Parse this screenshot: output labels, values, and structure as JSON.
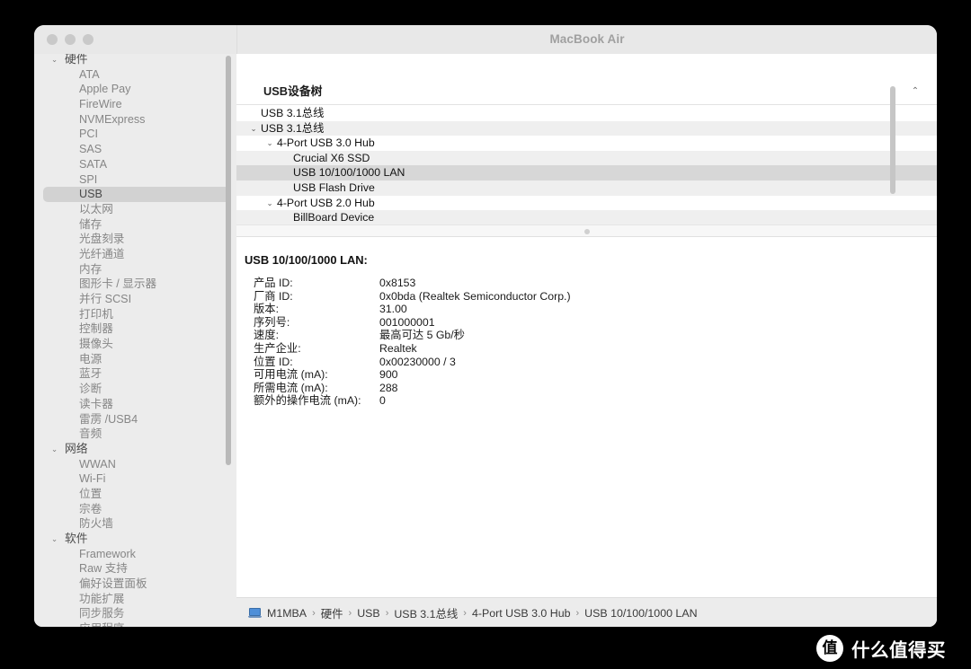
{
  "window": {
    "title": "MacBook Air",
    "traffic_lights": [
      "close-button",
      "minimize-button",
      "zoom-button"
    ]
  },
  "sidebar": {
    "groups": [
      {
        "label": "硬件",
        "expanded": true,
        "items": [
          {
            "label": "ATA",
            "selected": false
          },
          {
            "label": "Apple Pay",
            "selected": false
          },
          {
            "label": "FireWire",
            "selected": false
          },
          {
            "label": "NVMExpress",
            "selected": false
          },
          {
            "label": "PCI",
            "selected": false
          },
          {
            "label": "SAS",
            "selected": false
          },
          {
            "label": "SATA",
            "selected": false
          },
          {
            "label": "SPI",
            "selected": false
          },
          {
            "label": "USB",
            "selected": true
          },
          {
            "label": "以太网",
            "selected": false
          },
          {
            "label": "储存",
            "selected": false
          },
          {
            "label": "光盘刻录",
            "selected": false
          },
          {
            "label": "光纤通道",
            "selected": false
          },
          {
            "label": "内存",
            "selected": false
          },
          {
            "label": "图形卡 / 显示器",
            "selected": false
          },
          {
            "label": "并行 SCSI",
            "selected": false
          },
          {
            "label": "打印机",
            "selected": false
          },
          {
            "label": "控制器",
            "selected": false
          },
          {
            "label": "摄像头",
            "selected": false
          },
          {
            "label": "电源",
            "selected": false
          },
          {
            "label": "蓝牙",
            "selected": false
          },
          {
            "label": "诊断",
            "selected": false
          },
          {
            "label": "读卡器",
            "selected": false
          },
          {
            "label": "雷雳 /USB4",
            "selected": false
          },
          {
            "label": "音频",
            "selected": false
          }
        ]
      },
      {
        "label": "网络",
        "expanded": true,
        "items": [
          {
            "label": "WWAN",
            "selected": false
          },
          {
            "label": "Wi-Fi",
            "selected": false
          },
          {
            "label": "位置",
            "selected": false
          },
          {
            "label": "宗卷",
            "selected": false
          },
          {
            "label": "防火墙",
            "selected": false
          }
        ]
      },
      {
        "label": "软件",
        "expanded": true,
        "items": [
          {
            "label": "Framework",
            "selected": false
          },
          {
            "label": "Raw 支持",
            "selected": false
          },
          {
            "label": "偏好设置面板",
            "selected": false
          },
          {
            "label": "功能扩展",
            "selected": false
          },
          {
            "label": "同步服务",
            "selected": false
          },
          {
            "label": "应用程序",
            "selected": false
          }
        ]
      }
    ],
    "twisty_expanded_glyph": "⌄"
  },
  "tree": {
    "header_title": "USB设备树",
    "collapse_glyph": "⌃",
    "rows": [
      {
        "label": "USB 3.1总线",
        "depth": 0,
        "twisty": "",
        "stripe": false,
        "selected": false
      },
      {
        "label": "USB 3.1总线",
        "depth": 0,
        "twisty": "⌄",
        "stripe": true,
        "selected": false
      },
      {
        "label": "4-Port USB 3.0 Hub",
        "depth": 1,
        "twisty": "⌄",
        "stripe": false,
        "selected": false
      },
      {
        "label": "Crucial X6 SSD",
        "depth": 2,
        "twisty": "",
        "stripe": true,
        "selected": false
      },
      {
        "label": "USB 10/100/1000 LAN",
        "depth": 2,
        "twisty": "",
        "stripe": false,
        "selected": true
      },
      {
        "label": "USB Flash Drive",
        "depth": 2,
        "twisty": "",
        "stripe": true,
        "selected": false
      },
      {
        "label": "4-Port USB 2.0 Hub",
        "depth": 1,
        "twisty": "⌄",
        "stripe": false,
        "selected": false
      },
      {
        "label": "BillBoard Device",
        "depth": 2,
        "twisty": "",
        "stripe": true,
        "selected": false
      }
    ]
  },
  "detail": {
    "title": "USB 10/100/1000 LAN:",
    "properties": [
      {
        "label": "产品 ID:",
        "value": "0x8153"
      },
      {
        "label": "厂商 ID:",
        "value": "0x0bda  (Realtek Semiconductor Corp.)"
      },
      {
        "label": "版本:",
        "value": "31.00"
      },
      {
        "label": "序列号:",
        "value": "001000001"
      },
      {
        "label": "速度:",
        "value": "最高可达 5 Gb/秒"
      },
      {
        "label": "生产企业:",
        "value": "Realtek"
      },
      {
        "label": "位置 ID:",
        "value": "0x00230000 / 3"
      },
      {
        "label": "可用电流 (mA):",
        "value": "900"
      },
      {
        "label": "所需电流 (mA):",
        "value": "288"
      },
      {
        "label": "额外的操作电流 (mA):",
        "value": "0"
      }
    ]
  },
  "breadcrumb": {
    "icon": "laptop-icon",
    "separator": "›",
    "items": [
      "M1MBA",
      "硬件",
      "USB",
      "USB 3.1总线",
      "4-Port USB 3.0 Hub",
      "USB 10/100/1000 LAN"
    ]
  },
  "watermark": {
    "logo_glyph": "值",
    "text": "什么值得买"
  },
  "colors": {
    "window_bg": "#ececec",
    "content_bg": "#ffffff",
    "selection_gray": "#d2d2d2",
    "tree_selection": "#d7d7d7",
    "stripe": "#efefef",
    "accent_blue": "#4f8fd8",
    "desktop_bg": "#000000"
  }
}
